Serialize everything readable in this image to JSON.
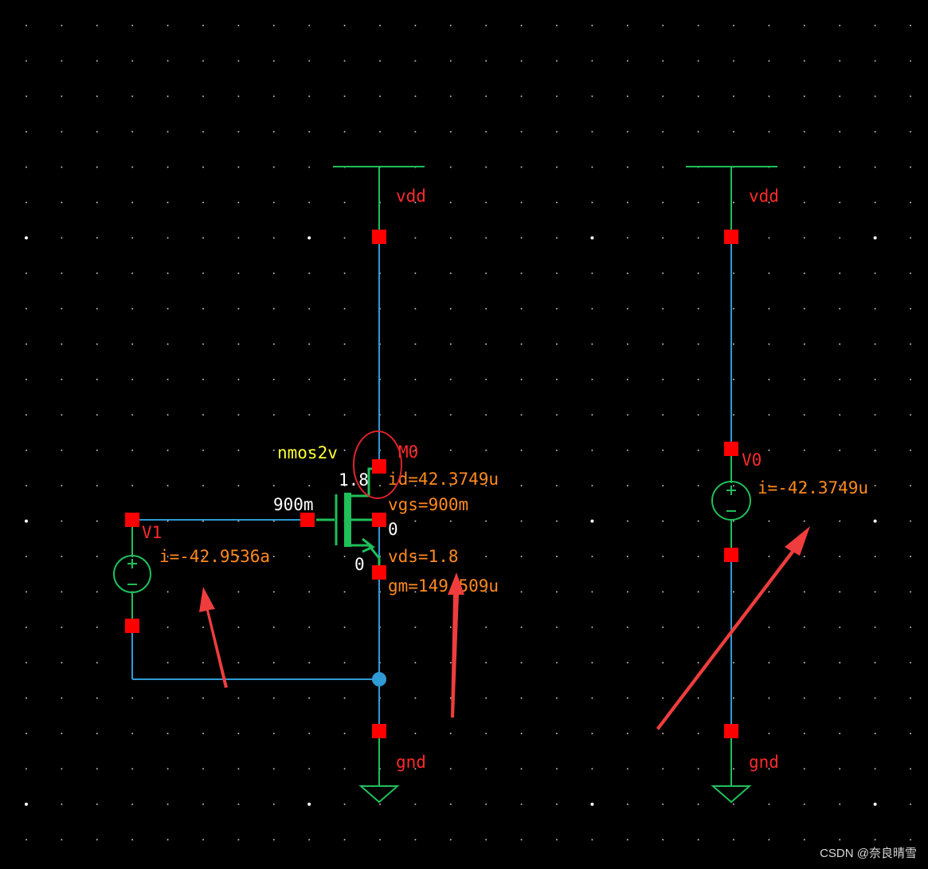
{
  "colors": {
    "background": "#000000",
    "wire": "#2f9bd6",
    "symbol": "#1fbf5a",
    "pin": "#ff0000",
    "net_label": "#ff2a2a",
    "annotation": "#ff8a1e",
    "cell_name": "#ffff33",
    "param": "#ffffff",
    "arrow": "#ef3d3d",
    "grid": "#bdbdbd"
  },
  "left_circuit": {
    "vdd_label": "vdd",
    "gnd_label": "gnd",
    "transistor": {
      "cell": "nmos2v",
      "instance": "M0",
      "drain_voltage": "1.8",
      "gate_voltage": "900m",
      "source_voltage": "0",
      "bulk_voltage": "0",
      "id": "id=42.3749u",
      "vgs": "vgs=900m",
      "vds": "vds=1.8",
      "gm": "gm=149.509u"
    },
    "source": {
      "instance": "V1",
      "current": "i=-42.9536a"
    }
  },
  "right_circuit": {
    "vdd_label": "vdd",
    "gnd_label": "gnd",
    "source": {
      "instance": "V0",
      "current": "i=-42.3749u"
    }
  },
  "watermark": "CSDN @奈良晴雪"
}
